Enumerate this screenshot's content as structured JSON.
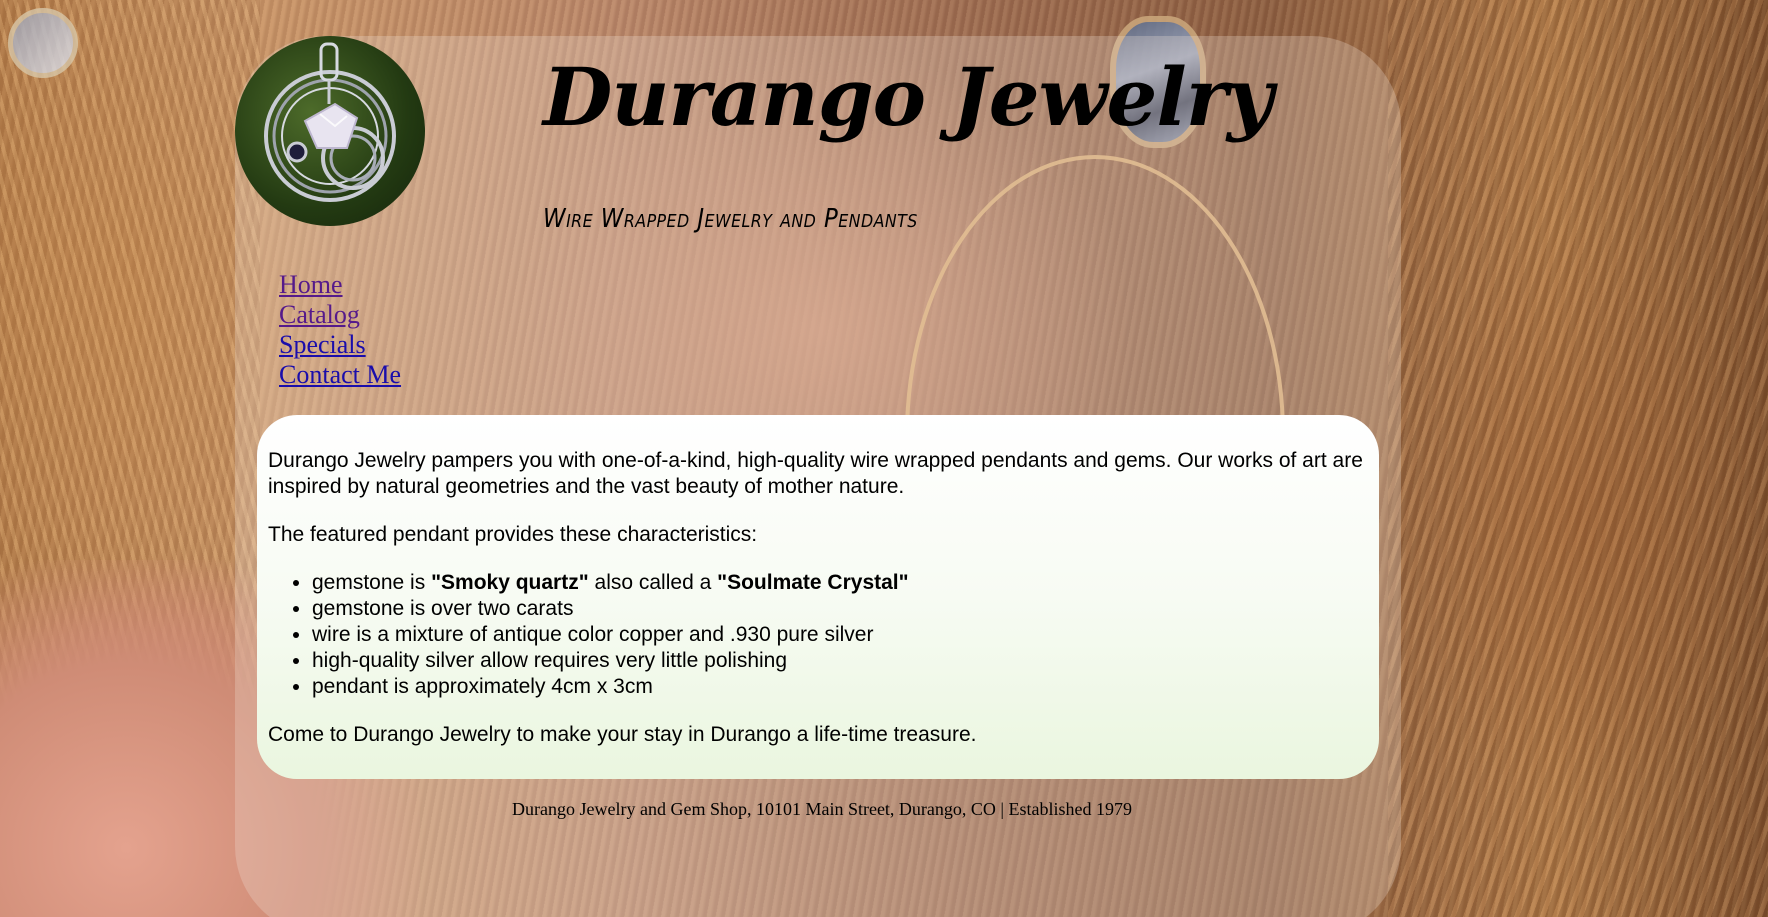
{
  "header": {
    "title": "Durango Jewelry",
    "tagline": "Wire Wrapped Jewelry and Pendants"
  },
  "nav": {
    "items": [
      {
        "label": "Home"
      },
      {
        "label": "Catalog"
      },
      {
        "label": "Specials"
      },
      {
        "label": "Contact Me"
      }
    ]
  },
  "content": {
    "intro": "Durango Jewelry pampers you with one-of-a-kind, high-quality wire wrapped pendants and gems. Our works of art are inspired by natural geometries and the vast beauty of mother nature.",
    "features_heading": "The featured pendant provides these characteristics:",
    "feature_1_prefix": "gemstone is ",
    "feature_1_bold_a": "\"Smoky quartz\"",
    "feature_1_middle": " also called a ",
    "feature_1_bold_b": "\"Soulmate Crystal\"",
    "features": [
      "gemstone is over two carats",
      "wire is a mixture of antique color copper and .930 pure silver",
      "high-quality silver allow requires very little polishing",
      "pendant is approximately 4cm x 3cm"
    ],
    "closing": "Come to Durango Jewelry to make your stay in Durango a life-time treasure."
  },
  "footer": {
    "text": "Durango Jewelry and Gem Shop, 10101 Main Street, Durango, CO | Established 1979"
  }
}
